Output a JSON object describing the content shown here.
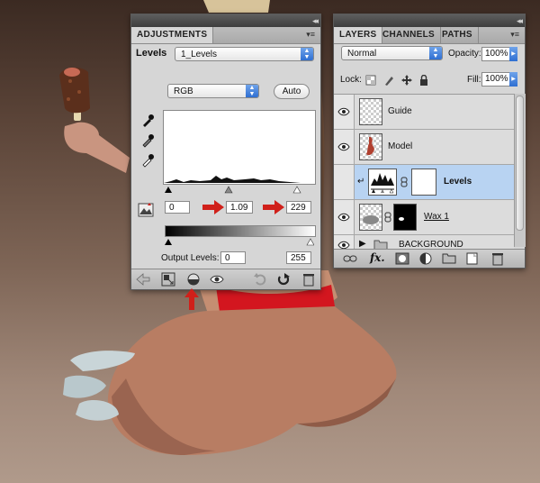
{
  "adjustments_panel": {
    "tab_label": "ADJUSTMENTS",
    "preset_label": "Levels",
    "preset_value": "1_Levels",
    "channel_value": "RGB",
    "auto_label": "Auto",
    "input_black": "0",
    "input_gamma": "1.09",
    "input_white": "229",
    "output_label": "Output Levels:",
    "output_black": "0",
    "output_white": "255"
  },
  "layers_panel": {
    "tabs": [
      "LAYERS",
      "CHANNELS",
      "PATHS"
    ],
    "blend_mode": "Normal",
    "opacity_label": "Opacity:",
    "opacity_value": "100%",
    "lock_label": "Lock:",
    "fill_label": "Fill:",
    "fill_value": "100%",
    "layers": [
      {
        "name": "Guide"
      },
      {
        "name": "Model"
      },
      {
        "name": "Levels"
      },
      {
        "name": "Wax 1"
      },
      {
        "name": "BACKGROUND"
      }
    ]
  },
  "colors": {
    "accent_blue": "#2f6fd2",
    "selected_row": "#b8d3f2",
    "annotation_red": "#d0201a"
  },
  "icons": [
    "eyedropper-black-icon",
    "eyedropper-gray-icon",
    "eyedropper-white-icon",
    "clip-warning-icon",
    "back-arrow-icon",
    "expand-icon",
    "clip-to-layer-icon",
    "visibility-icon",
    "reset-previous-icon",
    "reset-icon",
    "trash-icon",
    "eye-icon",
    "link-icon",
    "fx-icon",
    "mask-icon",
    "new-adjustment-icon",
    "group-icon",
    "new-layer-icon"
  ]
}
